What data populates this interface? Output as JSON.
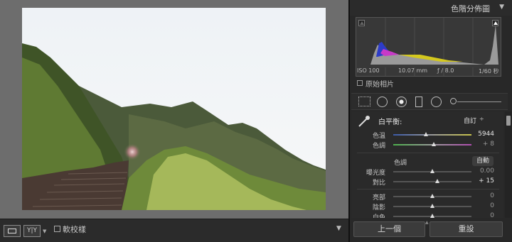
{
  "histogram": {
    "title": "色階分佈圖",
    "iso": "ISO 100",
    "focal_length": "10.07 mm",
    "aperture": "ƒ / 8.0",
    "shutter": "1/60 秒",
    "show_original_label": "原始相片"
  },
  "basic": {
    "wb_label": "白平衡:",
    "wb_value": "自訂",
    "wb_arrow": "÷",
    "tone_label": "色調",
    "auto_label": "自動",
    "sliders": [
      {
        "label": "色溫",
        "value": "5944",
        "position": 0.42
      },
      {
        "label": "色調",
        "value": "+ 8",
        "position": 0.52
      },
      {
        "label": "曝光度",
        "value": "0.00",
        "position": 0.5
      },
      {
        "label": "對比",
        "value": "+ 15",
        "position": 0.56
      },
      {
        "label": "亮部",
        "value": "0",
        "position": 0.5
      },
      {
        "label": "陰影",
        "value": "0",
        "position": 0.5
      },
      {
        "label": "白色",
        "value": "0",
        "position": 0.5
      }
    ]
  },
  "buttons": {
    "previous": "上一個",
    "reset": "重設"
  },
  "toolbar": {
    "softproof_label": "軟校樣",
    "compare_label": "Y|Y"
  },
  "colors": {
    "panel_bg": "#282828",
    "canvas_bg": "#6d6d6d"
  }
}
